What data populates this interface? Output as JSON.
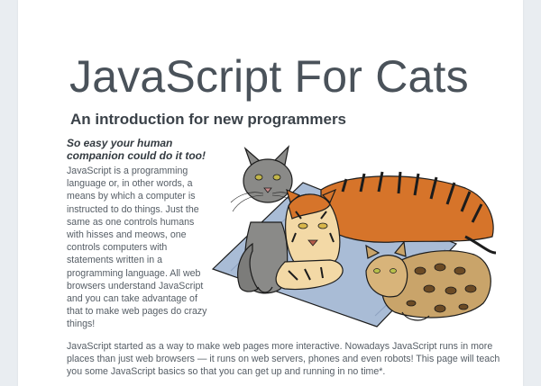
{
  "page": {
    "title": "JavaScript For Cats",
    "subtitle": "An introduction for new programmers",
    "tagline": "So easy your human companion could do it too!",
    "intro": "JavaScript is a programming language or, in other words, a means by which a computer is instructed to do things. Just the same as one controls humans with hisses and meows, one controls computers with statements written in a programming language. All web browsers understand JavaScript and you can take advantage of that to make web pages do crazy things!",
    "body": "JavaScript started as a way to make web pages more interactive. Nowadays JavaScript runs in more places than just web browsers — it runs on web servers, phones and even robots! This page will teach you some JavaScript basics so that you can get up and running in no time*."
  },
  "illustration": {
    "icon": "cats-illustration",
    "colors": {
      "blanket": "#a9bcd6",
      "gray_cat": "#8a8a88",
      "tiger_orange": "#d6742a",
      "tiger_light": "#f3d9a6",
      "ocelot": "#c9a46a",
      "outline": "#1c1c1c"
    }
  }
}
